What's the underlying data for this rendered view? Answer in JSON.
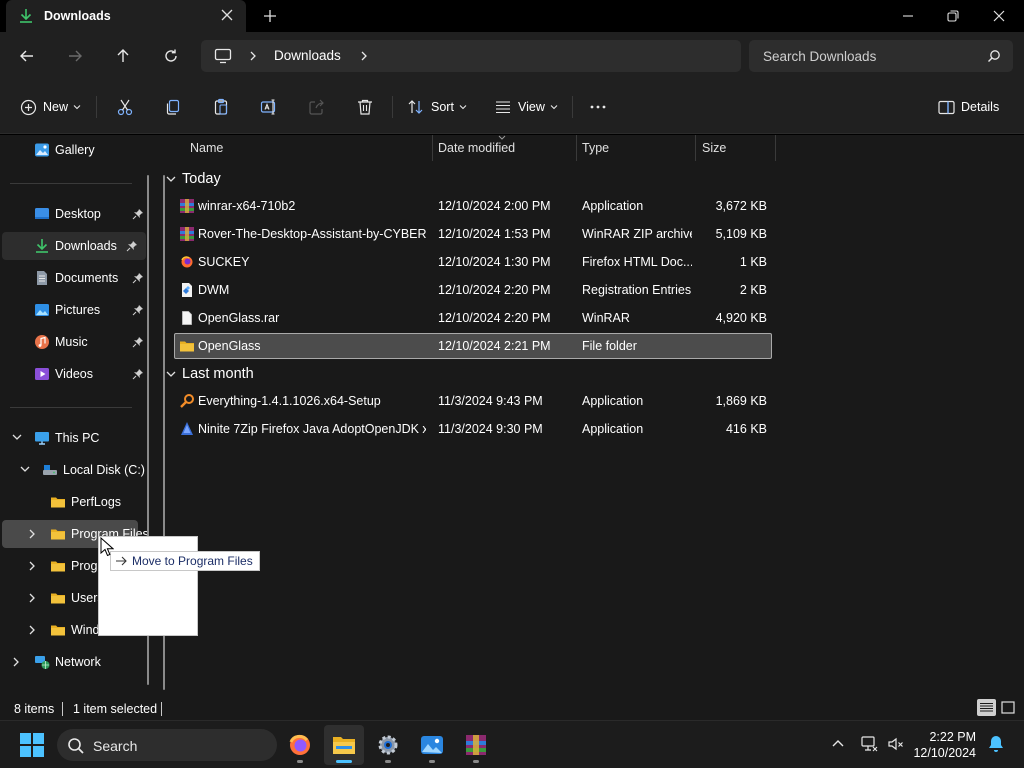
{
  "window": {
    "tab_title": "Downloads",
    "controls": {
      "minimize": "minimize",
      "maximize": "restore",
      "close": "close"
    }
  },
  "address": {
    "breadcrumb": "Downloads",
    "search_placeholder": "Search Downloads"
  },
  "commandbar": {
    "new_label": "New",
    "sort_label": "Sort",
    "view_label": "View",
    "details_label": "Details"
  },
  "navpane": {
    "gallery": "Gallery",
    "quick_access": [
      {
        "label": "Desktop"
      },
      {
        "label": "Downloads"
      },
      {
        "label": "Documents"
      },
      {
        "label": "Pictures"
      },
      {
        "label": "Music"
      },
      {
        "label": "Videos"
      }
    ],
    "this_pc": "This PC",
    "local_disk": "Local Disk (C:)",
    "folders": [
      "PerfLogs",
      "Program Files",
      "Prog",
      "Users",
      "Wind"
    ],
    "network": "Network"
  },
  "filelist": {
    "columns": {
      "name": "Name",
      "date": "Date modified",
      "type": "Type",
      "size": "Size"
    },
    "groups": [
      {
        "label": "Today",
        "rows": [
          {
            "name": "winrar-x64-710b2",
            "date": "12/10/2024 2:00 PM",
            "type": "Application",
            "size": "3,672 KB",
            "icon": "winrar-icon"
          },
          {
            "name": "Rover-The-Desktop-Assistant-by-CYBER...",
            "date": "12/10/2024 1:53 PM",
            "type": "WinRAR ZIP archive",
            "size": "5,109 KB",
            "icon": "winrar-archive-icon"
          },
          {
            "name": "SUCKEY",
            "date": "12/10/2024 1:30 PM",
            "type": "Firefox HTML Doc...",
            "size": "1 KB",
            "icon": "firefox-document-icon"
          },
          {
            "name": "DWM",
            "date": "12/10/2024 2:20 PM",
            "type": "Registration Entries",
            "size": "2 KB",
            "icon": "registry-icon"
          },
          {
            "name": "OpenGlass.rar",
            "date": "12/10/2024 2:20 PM",
            "type": "WinRAR",
            "size": "4,920 KB",
            "icon": "blank-file-icon"
          },
          {
            "name": "OpenGlass",
            "date": "12/10/2024 2:21 PM",
            "type": "File folder",
            "size": "",
            "icon": "folder-icon",
            "selected": true
          }
        ]
      },
      {
        "label": "Last month",
        "rows": [
          {
            "name": "Everything-1.4.1.1026.x64-Setup",
            "date": "11/3/2024 9:43 PM",
            "type": "Application",
            "size": "1,869 KB",
            "icon": "everything-search-icon"
          },
          {
            "name": "Ninite 7Zip Firefox Java AdoptOpenJDK x...",
            "date": "11/3/2024 9:30 PM",
            "type": "Application",
            "size": "416 KB",
            "icon": "ninite-icon"
          }
        ]
      }
    ]
  },
  "drag": {
    "tooltip": "Move to Program Files"
  },
  "statusbar": {
    "item_count": "8 items",
    "selection": "1 item selected"
  },
  "taskbar": {
    "search_label": "Search",
    "apps": [
      "firefox",
      "file-explorer",
      "settings",
      "photos",
      "winrar"
    ],
    "time": "2:22 PM",
    "date": "12/10/2024"
  },
  "colors": {
    "accent": "#4cc2ff",
    "folder": "#f3c23b",
    "selection": "#4c4c4c"
  }
}
